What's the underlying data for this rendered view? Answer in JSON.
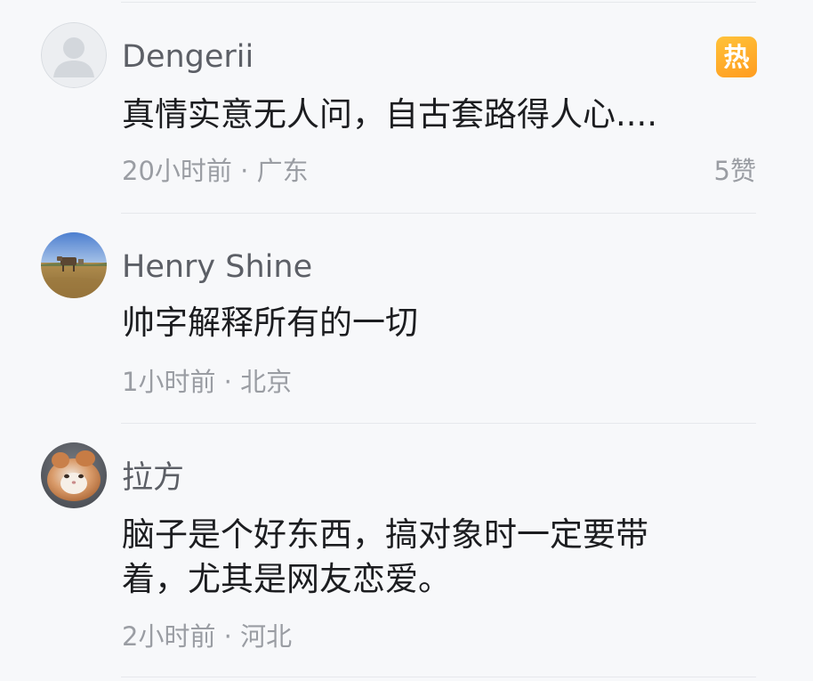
{
  "comments": [
    {
      "username": "Dengerii",
      "avatar": "default-user-icon",
      "hot_badge": "热",
      "content": "真情实意无人问，自古套路得人心....",
      "time": "20小时前",
      "separator": " · ",
      "location": "广东",
      "likes": "5赞"
    },
    {
      "username": "Henry Shine",
      "avatar": "landscape-photo-avatar",
      "content": "帅字解释所有的一切",
      "time": "1小时前",
      "separator": " · ",
      "location": "北京"
    },
    {
      "username": "拉方",
      "avatar": "cat-photo-avatar",
      "content": "脑子是个好东西，搞对象时一定要带着，尤其是网友恋爱。",
      "time": "2小时前",
      "separator": " · ",
      "location": "河北"
    }
  ],
  "colors": {
    "background": "#f7f8fa",
    "username": "#5c5f66",
    "content": "#1c1d20",
    "meta": "#9a9da3",
    "hot_badge": "#ffb02e"
  }
}
